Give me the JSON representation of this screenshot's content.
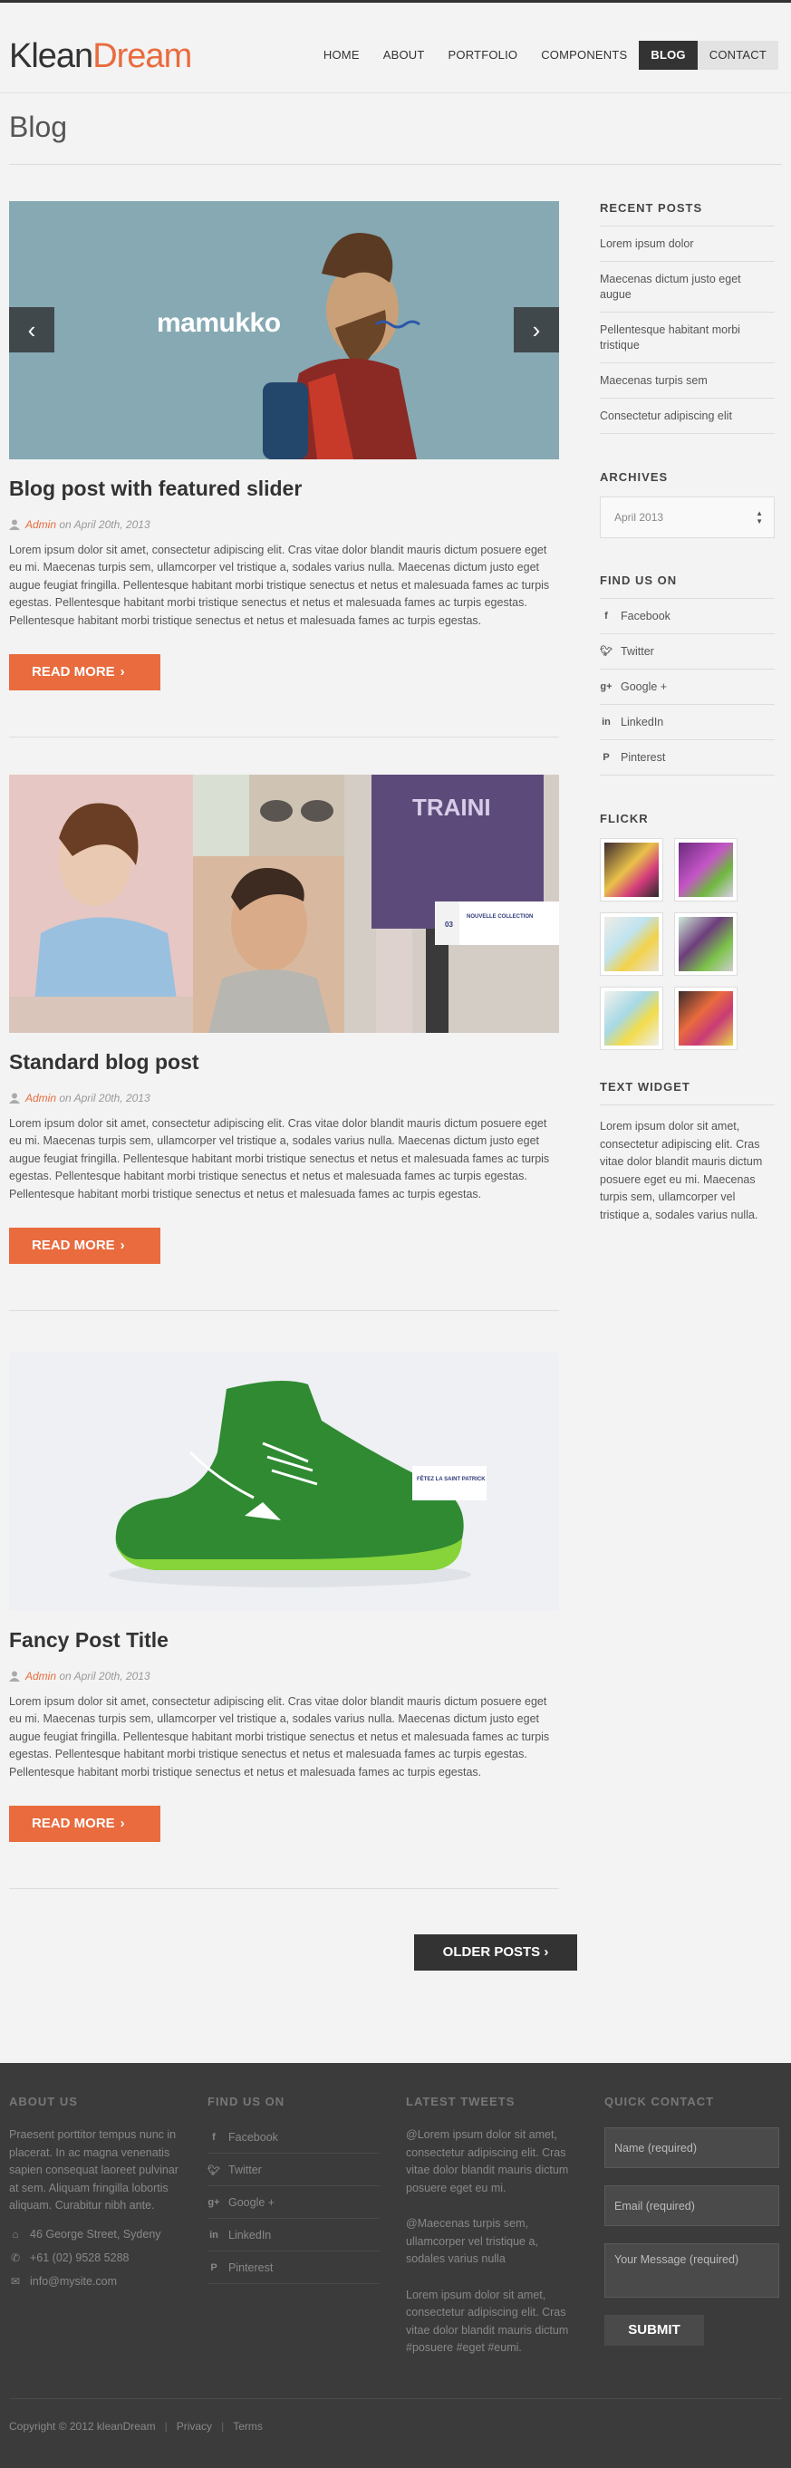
{
  "logo": {
    "part1": "Klean",
    "part2": "Dream"
  },
  "nav": [
    "HOME",
    "ABOUT",
    "PORTFOLIO",
    "COMPONENTS",
    "BLOG",
    "CONTACT"
  ],
  "page_title": "Blog",
  "slider": {
    "brand_text": "mamukko",
    "prev": "‹",
    "next": "›"
  },
  "posts": [
    {
      "title": "Blog post with featured slider",
      "author": "Admin",
      "date": "on April 20th, 2013",
      "excerpt": "Lorem ipsum dolor sit amet, consectetur adipiscing elit. Cras vitae dolor blandit mauris dictum posuere eget eu mi. Maecenas turpis sem, ullamcorper vel tristique a, sodales varius nulla. Maecenas dictum justo eget augue feugiat fringilla. Pellentesque habitant morbi tristique senectus et netus et malesuada fames ac turpis egestas. Pellentesque habitant morbi tristique senectus et netus et malesuada fames ac turpis egestas. Pellentesque habitant morbi tristique senectus et netus et malesuada fames ac turpis egestas.",
      "button": "READ MORE"
    },
    {
      "title": "Standard blog post",
      "author": "Admin",
      "date": "on April 20th, 2013",
      "excerpt": "Lorem ipsum dolor sit amet, consectetur adipiscing elit. Cras vitae dolor blandit mauris dictum posuere eget eu mi. Maecenas turpis sem, ullamcorper vel tristique a, sodales varius nulla. Maecenas dictum justo eget augue feugiat fringilla. Pellentesque habitant morbi tristique senectus et netus et malesuada fames ac turpis egestas. Pellentesque habitant morbi tristique senectus et netus et malesuada fames ac turpis egestas. Pellentesque habitant morbi tristique senectus et netus et malesuada fames ac turpis egestas.",
      "button": "READ MORE",
      "image_caption": {
        "number": "03",
        "title": "NOUVELLE COLLECTION"
      }
    },
    {
      "title": "Fancy Post Title",
      "author": "Admin",
      "date": "on April 20th, 2013",
      "excerpt": "Lorem ipsum dolor sit amet, consectetur adipiscing elit. Cras vitae dolor blandit mauris dictum posuere eget eu mi. Maecenas turpis sem, ullamcorper vel tristique a, sodales varius nulla. Maecenas dictum justo eget augue feugiat fringilla. Pellentesque habitant morbi tristique senectus et netus et malesuada fames ac turpis egestas. Pellentesque habitant morbi tristique senectus et netus et malesuada fames ac turpis egestas. Pellentesque habitant morbi tristique senectus et netus et malesuada fames ac turpis egestas.",
      "button": "READ MORE",
      "image_caption": {
        "title": "FÊTEZ LA SAINT PATRICK"
      }
    }
  ],
  "older_posts": "OLDER POSTS",
  "sidebar": {
    "recent_title": "RECENT POSTS",
    "recent": [
      "Lorem ipsum dolor",
      "Maecenas dictum justo eget augue",
      "Pellentesque habitant morbi tristique",
      "Maecenas turpis sem",
      "Consectetur adipiscing elit"
    ],
    "archives_title": "ARCHIVES",
    "archives_value": "April 2013",
    "find_title": "FIND US ON",
    "social": [
      "Facebook",
      "Twitter",
      "Google +",
      "LinkedIn",
      "Pinterest"
    ],
    "flickr_title": "FLICKR",
    "text_title": "TEXT WIDGET",
    "text_body": "Lorem ipsum dolor sit amet, consectetur adipiscing elit. Cras vitae dolor blandit mauris dictum posuere eget eu mi. Maecenas turpis sem, ullamcorper vel tristique a, sodales varius nulla."
  },
  "footer": {
    "about_title": "ABOUT US",
    "about_text": "Praesent porttitor tempus nunc in placerat. In ac magna venenatis sapien consequat laoreet pulvinar at sem. Aliquam fringilla lobortis aliquam. Curabitur nibh ante.",
    "address": "46 George Street, Sydeny",
    "phone": "+61 (02) 9528 5288",
    "email": "info@mysite.com",
    "find_title": "FIND US ON",
    "social": [
      "Facebook",
      "Twitter",
      "Google +",
      "LinkedIn",
      "Pinterest"
    ],
    "tweets_title": "LATEST TWEETS",
    "tweets": [
      "@Lorem ipsum dolor sit amet, consectetur adipiscing elit. Cras vitae dolor blandit mauris dictum posuere eget eu mi.",
      "@Maecenas turpis sem, ullamcorper vel tristique a, sodales varius nulla",
      "Lorem ipsum dolor sit amet, consectetur adipiscing elit. Cras vitae dolor blandit mauris dictum #posuere #eget #eumi."
    ],
    "contact_title": "QUICK CONTACT",
    "name_placeholder": "Name (required)",
    "email_placeholder": "Email (required)",
    "message_placeholder": "Your Message (required)",
    "submit": "SUBMIT",
    "copyright": "Copyright © 2012 kleanDream",
    "links": [
      "Privacy",
      "Terms"
    ]
  }
}
